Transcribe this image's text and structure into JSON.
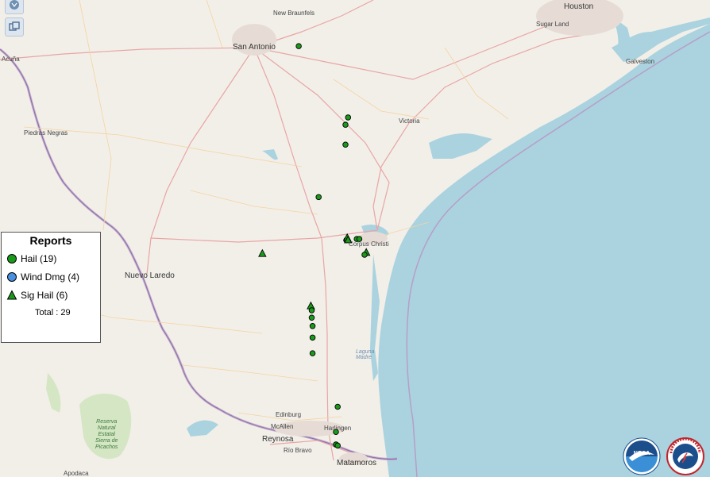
{
  "legend": {
    "title": "Reports",
    "items": [
      {
        "label": "Hail (19)",
        "color": "#1a9a1a",
        "shape": "circle"
      },
      {
        "label": "Wind Dmg (4)",
        "color": "#4a90e2",
        "shape": "circle"
      },
      {
        "label": "Sig Hail (6)",
        "color": "#1a9a1a",
        "shape": "triangle"
      }
    ],
    "total": "Total : 29"
  },
  "controls": {
    "top_icon": "globe-icon",
    "layers_icon": "layers-icon"
  },
  "places": {
    "houston": "Houston",
    "sugarland": "Sugar Land",
    "galveston": "Galveston",
    "new_braunfels": "New Braunfels",
    "san_antonio": "San Antonio",
    "acuna": "Acuña",
    "piedras_negras": "Piedras Negras",
    "victoria": "Victoria",
    "corpus_christi": "Corpus Christi",
    "nuevo_laredo": "Nuevo Laredo",
    "laguna_madre": "Laguna\nMadre",
    "reserva": "Reserva\nNatural\nEstatal\nSierra de\nPicachos",
    "edinburg": "Edinburg",
    "mcallen": "McAllen",
    "harlingen": "Harlingen",
    "reynosa": "Reynosa",
    "rio_bravo": "Río Bravo",
    "matamoros": "Matamoros",
    "apodaca": "Apodaca"
  },
  "logos": {
    "noaa": "NOAA",
    "nws": "National Weather Service"
  },
  "colors": {
    "water": "#aad3df",
    "land": "#f2efe9",
    "border": "#9e7fb0",
    "hail": "#1a9a1a",
    "wind": "#4a90e2"
  },
  "reports": [
    {
      "type": "hail",
      "lon": -97.95,
      "lat": 29.66
    },
    {
      "type": "hail",
      "lon": -97.38,
      "lat": 28.98
    },
    {
      "type": "hail",
      "lon": -97.41,
      "lat": 28.91
    },
    {
      "type": "hail",
      "lon": -97.41,
      "lat": 28.72
    },
    {
      "type": "hail",
      "lon": -97.72,
      "lat": 28.22
    },
    {
      "type": "wind",
      "lon": -97.4,
      "lat": 27.81
    },
    {
      "type": "sighail",
      "lon": -97.39,
      "lat": 27.83
    },
    {
      "type": "sighail",
      "lon": -97.38,
      "lat": 27.81
    },
    {
      "type": "hail",
      "lon": -97.28,
      "lat": 27.82
    },
    {
      "type": "hail",
      "lon": -97.25,
      "lat": 27.82
    },
    {
      "type": "sighail",
      "lon": -97.17,
      "lat": 27.69
    },
    {
      "type": "hail",
      "lon": -97.19,
      "lat": 27.67
    },
    {
      "type": "sighail",
      "lon": -98.37,
      "lat": 27.68
    },
    {
      "type": "sighail",
      "lon": -97.81,
      "lat": 27.18
    },
    {
      "type": "hail",
      "lon": -97.8,
      "lat": 27.14
    },
    {
      "type": "hail",
      "lon": -97.8,
      "lat": 27.07
    },
    {
      "type": "hail",
      "lon": -97.79,
      "lat": 26.99
    },
    {
      "type": "hail",
      "lon": -97.79,
      "lat": 26.88
    },
    {
      "type": "hail",
      "lon": -97.79,
      "lat": 26.73
    },
    {
      "type": "hail",
      "lon": -97.5,
      "lat": 26.22
    },
    {
      "type": "hail",
      "lon": -97.52,
      "lat": 25.98
    },
    {
      "type": "hail",
      "lon": -97.52,
      "lat": 25.86
    },
    {
      "type": "hail",
      "lon": -97.5,
      "lat": 25.85
    }
  ]
}
